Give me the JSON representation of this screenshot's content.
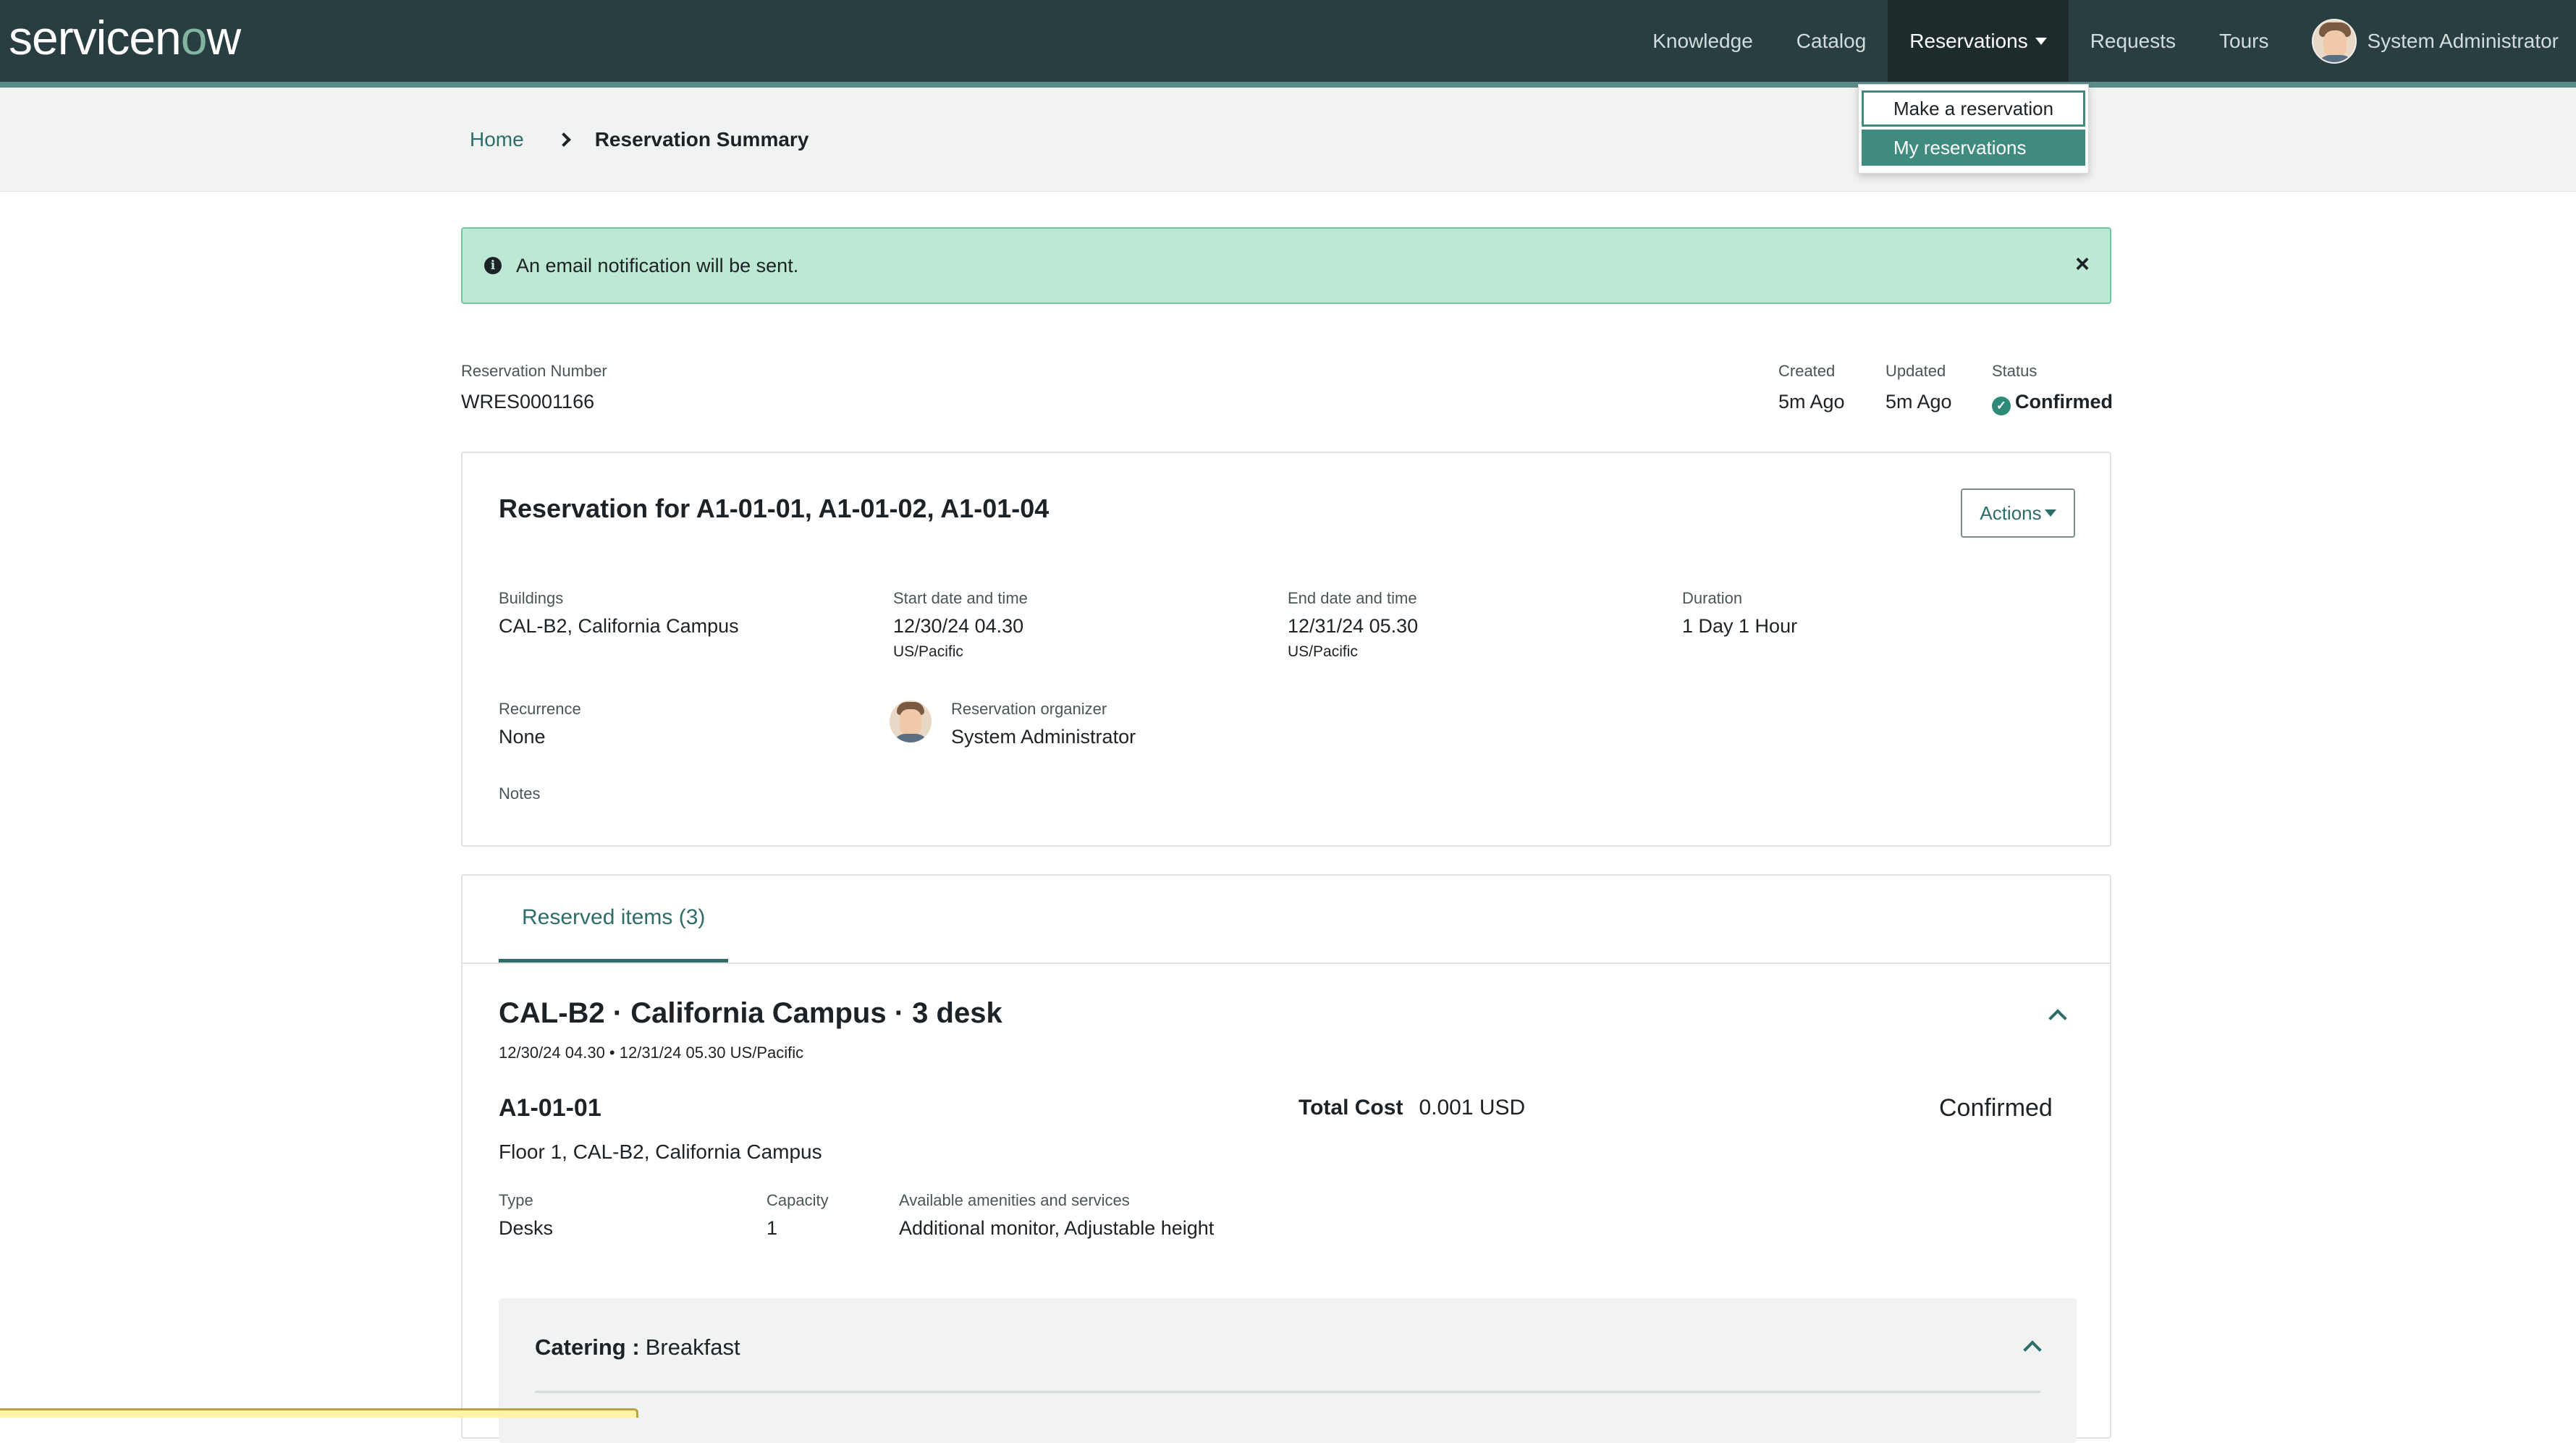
{
  "header": {
    "logo_text_a": "servicen",
    "logo_text_o": "o",
    "logo_text_b": "w",
    "nav": [
      "Knowledge",
      "Catalog",
      "Reservations",
      "Requests",
      "Tours"
    ],
    "user_name": "System Administrator"
  },
  "dropdown": {
    "items": [
      "Make a reservation",
      "My reservations"
    ]
  },
  "breadcrumb": {
    "home": "Home",
    "current": "Reservation Summary"
  },
  "alert": {
    "text": "An email notification will be sent."
  },
  "meta": {
    "reservation_number_label": "Reservation Number",
    "reservation_number": "WRES0001166",
    "created_label": "Created",
    "created": "5m Ago",
    "updated_label": "Updated",
    "updated": "5m Ago",
    "status_label": "Status",
    "status": "Confirmed"
  },
  "card": {
    "title": "Reservation for A1-01-01, A1-01-02, A1-01-04",
    "actions_label": "Actions",
    "buildings_label": "Buildings",
    "buildings": "CAL-B2, California Campus",
    "start_label": "Start date and time",
    "start": "12/30/24 04.30",
    "start_tz": "US/Pacific",
    "end_label": "End date and time",
    "end": "12/31/24 05.30",
    "end_tz": "US/Pacific",
    "duration_label": "Duration",
    "duration": "1 Day 1 Hour",
    "recurrence_label": "Recurrence",
    "recurrence": "None",
    "organizer_label": "Reservation organizer",
    "organizer": "System Administrator",
    "notes_label": "Notes"
  },
  "reserved": {
    "tab_label": "Reserved items (3)",
    "group_title": "CAL-B2 · California Campus · 3 desk",
    "group_sub": "12/30/24 04.30 • 12/31/24 05.30 US/Pacific",
    "item_name": "A1-01-01",
    "total_label": "Total Cost",
    "total_value": "0.001 USD",
    "item_status": "Confirmed",
    "floor": "Floor 1, CAL-B2, California Campus",
    "type_label": "Type",
    "type": "Desks",
    "capacity_label": "Capacity",
    "capacity": "1",
    "amenities_label": "Available amenities and services",
    "amenities": "Additional monitor, Adjustable height",
    "catering_label": "Catering :",
    "catering_value": "Breakfast"
  },
  "colors": {
    "header_bg": "#293e40",
    "accent": "#2e6d6a",
    "alert_bg": "#bde8d4",
    "selected": "#3f8b7d"
  }
}
